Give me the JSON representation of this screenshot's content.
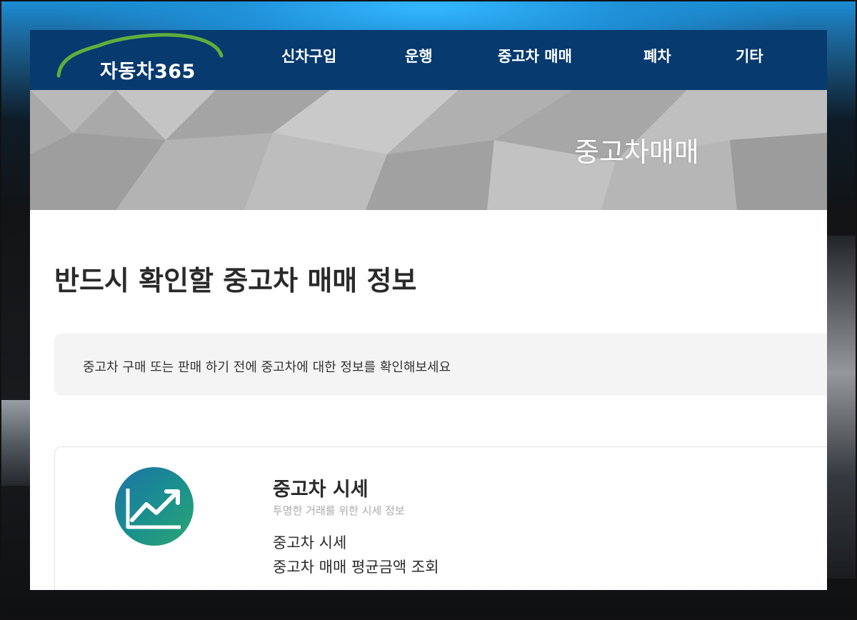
{
  "site": {
    "logo_text": "자동차365"
  },
  "nav": {
    "items": [
      "신차구입",
      "운행",
      "중고차 매매",
      "폐차",
      "기타"
    ]
  },
  "banner": {
    "title": "중고차매매"
  },
  "main": {
    "heading": "반드시 확인할 중고차 매매 정보",
    "notice": "중고차 구매 또는 판매 하기 전에 중고차에 대한 정보를 확인해보세요",
    "card": {
      "icon": "trend-chart-icon",
      "title": "중고차 시세",
      "subtitle": "투명한 거래를 위한 시세 정보",
      "links": [
        "중고차 시세",
        "중고차 매매 평균금액 조회"
      ]
    }
  },
  "colors": {
    "header_bg": "#073a6e",
    "logo_arc": "#5fae3c",
    "banner_bg": "#a9a9a9",
    "notice_bg": "#f4f4f4"
  }
}
